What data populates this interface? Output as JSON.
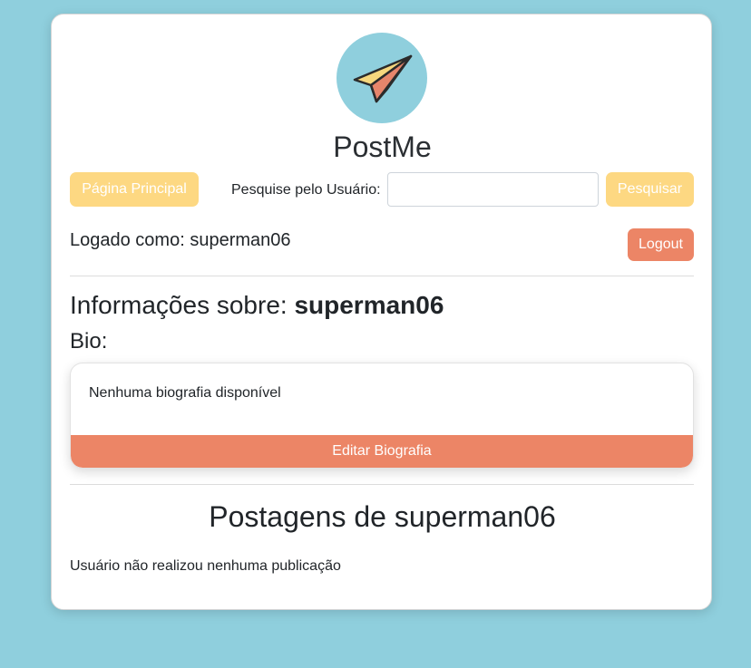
{
  "app": {
    "title": "PostMe",
    "logo_icon": "paper-plane-icon"
  },
  "colors": {
    "background": "#8fcfdd",
    "yellow_button": "#fdd882",
    "orange_button": "#ec8566"
  },
  "nav": {
    "home_label": "Página Principal",
    "search_label": "Pesquise pelo Usuário:",
    "search_value": "",
    "search_button": "Pesquisar"
  },
  "session": {
    "logged_as_prefix": "Logado como: ",
    "username": "superman06",
    "logout_label": "Logout"
  },
  "profile": {
    "info_prefix": "Informações sobre: ",
    "username": "superman06",
    "bio_label": "Bio:",
    "bio_text": "Nenhuma biografia disponível",
    "edit_bio_label": "Editar Biografia"
  },
  "posts": {
    "title": "Postagens de superman06",
    "empty_message": "Usuário não realizou nenhuma publicação"
  }
}
